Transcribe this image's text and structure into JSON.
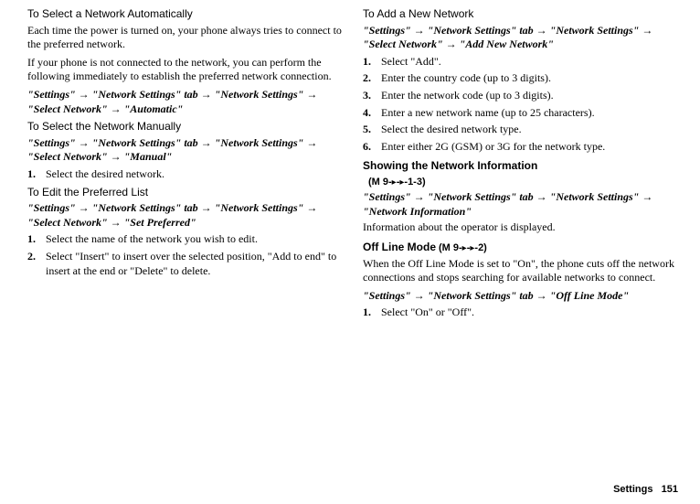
{
  "col1": {
    "sec1": {
      "heading": "To Select a Network Automatically",
      "p1": "Each time the power is turned on, your phone always tries to connect to the preferred network.",
      "p2": "If your phone is not connected to the network, you can perform the following immediately to establish the preferred network connection.",
      "path": "\"Settings\" → \"Network Settings\" tab → \"Network Settings\" → \"Select Network\" → \"Automatic\""
    },
    "sec2": {
      "heading": "To Select the Network Manually",
      "path": "\"Settings\" → \"Network Settings\" tab → \"Network Settings\" → \"Select Network\" → \"Manual\"",
      "step1_num": "1.",
      "step1": "Select the desired network."
    },
    "sec3": {
      "heading": "To Edit the Preferred List",
      "path": "\"Settings\" → \"Network Settings\" tab → \"Network Settings\" → \"Select Network\" → \"Set Preferred\"",
      "step1_num": "1.",
      "step1": "Select the name of the network you wish to edit.",
      "step2_num": "2.",
      "step2": "Select \"Insert\" to insert over the selected position, \"Add to end\" to insert at the end or \"Delete\" to delete."
    }
  },
  "col2": {
    "sec1": {
      "heading": "To Add a New Network",
      "path": "\"Settings\" → \"Network Settings\" tab → \"Network Settings\" → \"Select Network\" → \"Add New Network\"",
      "step1_num": "1.",
      "step1": "Select \"Add\".",
      "step2_num": "2.",
      "step2": "Enter the country code (up to 3 digits).",
      "step3_num": "3.",
      "step3": "Enter the network code (up to 3 digits).",
      "step4_num": "4.",
      "step4": "Enter a new network name (up to 25 characters).",
      "step5_num": "5.",
      "step5": "Select the desired network type.",
      "step6_num": "6.",
      "step6": "Enter either 2G (GSM) or 3G for the network type."
    },
    "sec2": {
      "heading": "Showing the Network Information",
      "menu_a": "(M 9-",
      "menu_b": "-",
      "menu_c": "-1-3)",
      "path": "\"Settings\" → \"Network Settings\" tab → \"Network Settings\" → \"Network Information\"",
      "p1": "Information about the operator is displayed."
    },
    "sec3": {
      "heading": "Off Line Mode",
      "menu_a": " (M 9-",
      "menu_b": "-",
      "menu_c": "-2)",
      "p1": "When the Off Line Mode is set to \"On\", the phone cuts off the network connections and stops searching for available networks to connect.",
      "path": "\"Settings\" → \"Network Settings\" tab → \"Off Line Mode\"",
      "step1_num": "1.",
      "step1": "Select \"On\" or \"Off\"."
    }
  },
  "footer": {
    "section": "Settings",
    "page": "151"
  },
  "icons": {
    "right_triangle": "▸"
  }
}
